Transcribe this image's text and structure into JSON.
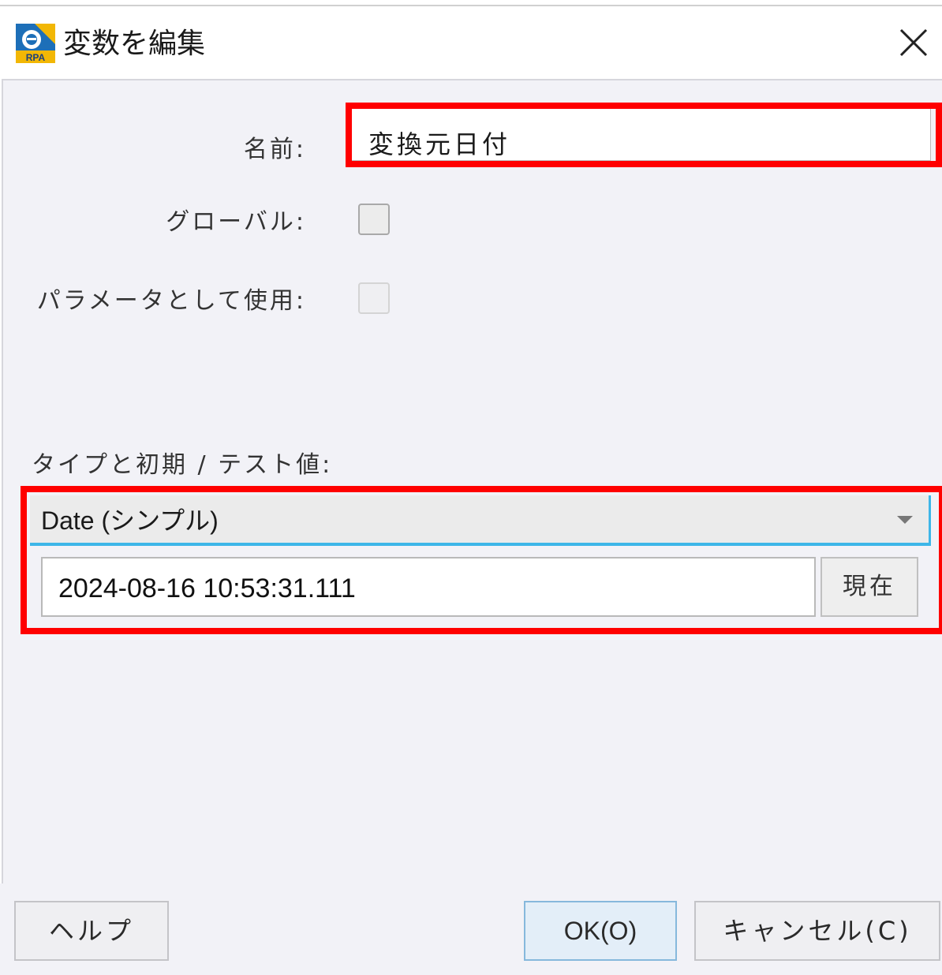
{
  "window": {
    "title": "変数を編集",
    "icon": "rpa-app-icon",
    "icon_text": "RPA",
    "close_icon": "close-icon"
  },
  "form": {
    "name_label": "名前:",
    "name_value": "変換元日付",
    "global_label": "グローバル:",
    "global_checked": false,
    "param_label": "パラメータとして使用:",
    "param_checked": false,
    "type_section_label": "タイプと初期 / テスト値:",
    "type_selected": "Date (シンプル)",
    "date_value": "2024-08-16 10:53:31.111",
    "now_button": "現在"
  },
  "footer": {
    "help_button": "ヘルプ",
    "ok_button": "OK(O)",
    "cancel_button": "キャンセル(C)"
  },
  "colors": {
    "highlight": "#ff0000",
    "focus_accent": "#3db6e8",
    "background": "#f2f2f7"
  }
}
